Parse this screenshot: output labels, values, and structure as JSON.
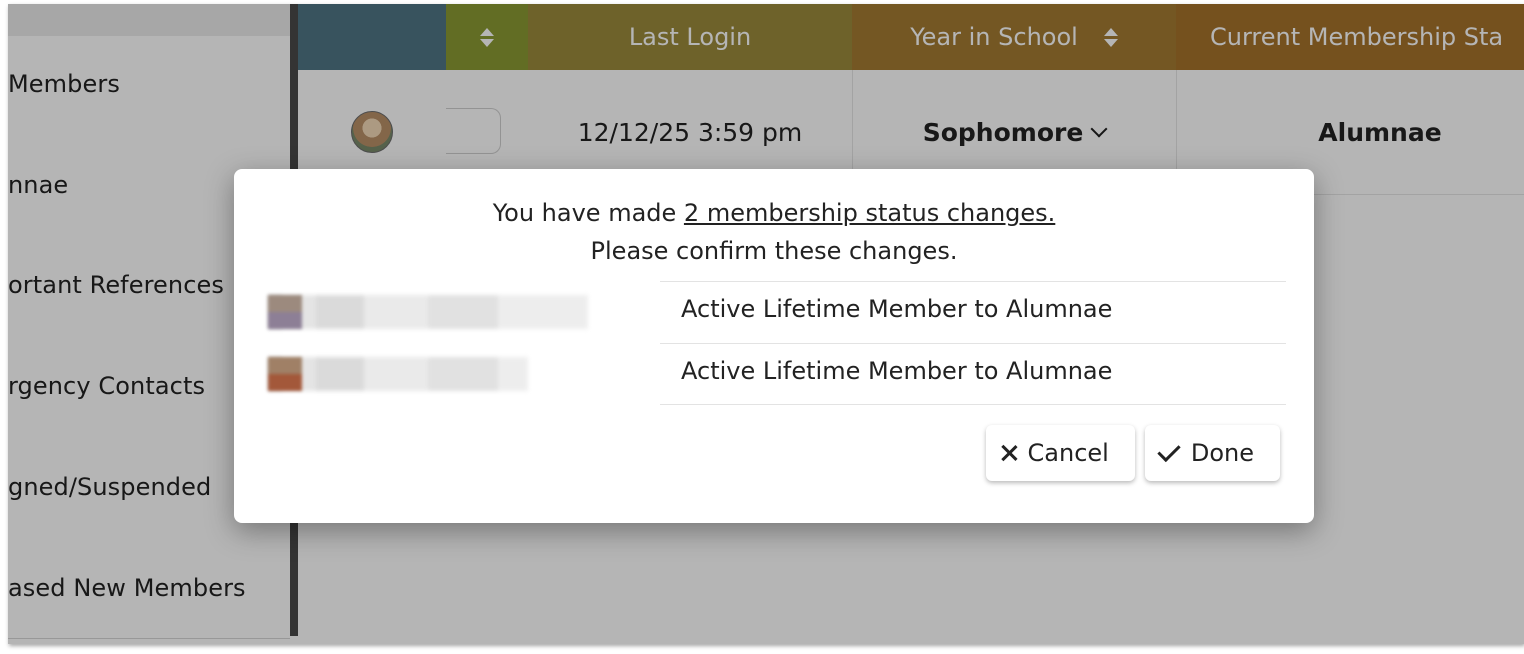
{
  "sidebar": {
    "items": [
      {
        "label": " Members"
      },
      {
        "label": "nnae"
      },
      {
        "label": "ortant References"
      },
      {
        "label": "rgency Contacts"
      },
      {
        "label": "gned/Suspended"
      },
      {
        "label": "ased New Members"
      }
    ]
  },
  "table": {
    "columns": [
      {
        "label": ""
      },
      {
        "label": ""
      },
      {
        "label": "Last Login"
      },
      {
        "label": "Year in School"
      },
      {
        "label": "Current Membership Sta"
      }
    ],
    "row": {
      "last_login": "12/12/25 3:59 pm",
      "year_in_school": "Sophomore",
      "membership_status": "Alumnae"
    }
  },
  "colors": {
    "header_col_a": "#4f7585",
    "header_col_b": "#8a9a34",
    "header_col_c": "#9b8a3c",
    "header_col_d": "#a47b32",
    "header_col_e": "#a5722b"
  },
  "dialog": {
    "message_prefix": "You have made ",
    "message_link": "2 membership status changes.",
    "message_line2": "Please confirm these changes.",
    "changes": [
      {
        "text": "Active Lifetime Member to Alumnae"
      },
      {
        "text": "Active Lifetime Member to Alumnae"
      }
    ],
    "cancel_label": "Cancel",
    "done_label": "Done"
  }
}
